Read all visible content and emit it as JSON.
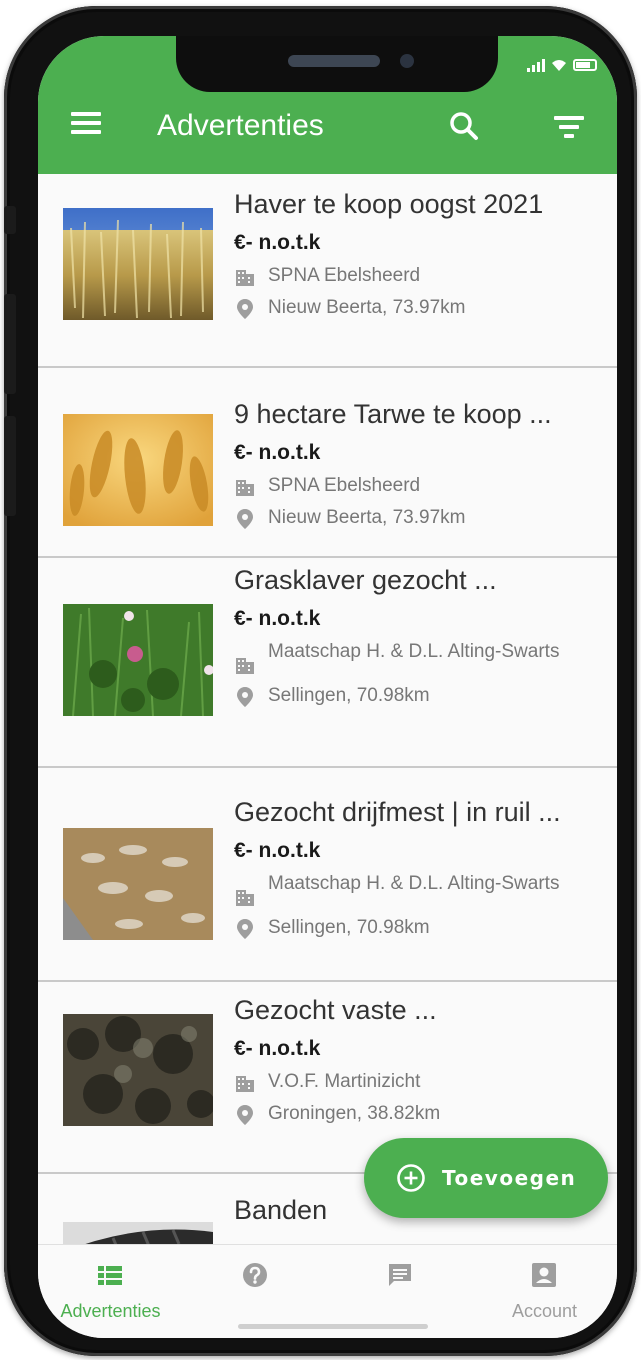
{
  "app": {
    "title": "Advertenties",
    "accent_color": "#4caf50"
  },
  "listings": [
    {
      "title": "Haver te koop oogst 2021",
      "price": "€- n.o.t.k",
      "company": "SPNA Ebelsheerd",
      "location": "Nieuw Beerta, 73.97km",
      "image": "oats-field-photo"
    },
    {
      "title": "9 hectare Tarwe te koop ...",
      "price": "€- n.o.t.k",
      "company": "SPNA Ebelsheerd",
      "location": "Nieuw Beerta, 73.97km",
      "image": "wheat-closeup-photo"
    },
    {
      "title": "Grasklaver gezocht ...",
      "price": "€- n.o.t.k",
      "company": "Maatschap H. & D.L. Alting-Swarts",
      "location": "Sellingen, 70.98km",
      "image": "clover-grass-photo"
    },
    {
      "title": "Gezocht drijfmest | in ruil ...",
      "price": "€- n.o.t.k",
      "company": "Maatschap H. & D.L. Alting-Swarts",
      "location": "Sellingen, 70.98km",
      "image": "manure-pit-photo"
    },
    {
      "title": "Gezocht vaste ...",
      "price": "€- n.o.t.k",
      "company": "V.O.F. Martinizicht",
      "location": "Groningen, 38.82km",
      "image": "solid-manure-photo"
    },
    {
      "title": "Banden",
      "image": "tires-photo"
    }
  ],
  "fab": {
    "label": "Toevoegen",
    "icon": "add-circle-icon"
  },
  "bottom_nav": [
    {
      "label": "Advertenties",
      "icon": "list-icon",
      "active": true
    },
    {
      "label": "",
      "icon": "help-icon",
      "active": false
    },
    {
      "label": "",
      "icon": "chat-icon",
      "active": false
    },
    {
      "label": "Account",
      "icon": "account-box-icon",
      "active": false
    }
  ]
}
